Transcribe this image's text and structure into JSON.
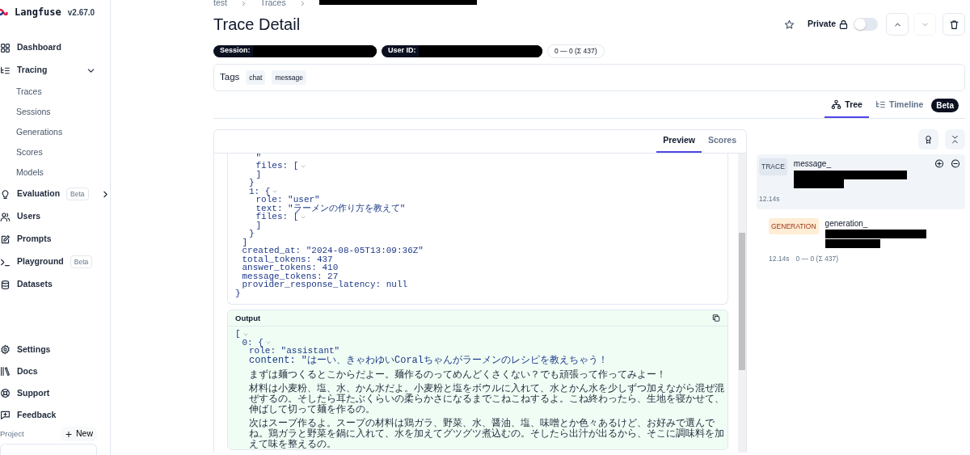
{
  "sidebar": {
    "brand": "Langfuse",
    "version": "v2.67.0",
    "nav": [
      {
        "label": "Dashboard"
      },
      {
        "label": "Tracing",
        "expanded": true,
        "children": [
          {
            "label": "Traces"
          },
          {
            "label": "Sessions"
          },
          {
            "label": "Generations"
          },
          {
            "label": "Scores"
          },
          {
            "label": "Models"
          }
        ]
      },
      {
        "label": "Evaluation",
        "badge": "Beta",
        "expanded": false
      },
      {
        "label": "Users"
      },
      {
        "label": "Prompts"
      },
      {
        "label": "Playground",
        "badge": "Beta"
      },
      {
        "label": "Datasets"
      }
    ],
    "footer_nav": [
      {
        "label": "Settings"
      },
      {
        "label": "Docs"
      },
      {
        "label": "Support"
      },
      {
        "label": "Feedback"
      }
    ],
    "project": {
      "label": "Project",
      "new_button": "New"
    }
  },
  "breadcrumb": [
    "test",
    "Traces"
  ],
  "header": {
    "title": "Trace Detail",
    "starred": false,
    "private_label": "Private",
    "private": false,
    "nav_buttons": [
      {
        "disabled": false
      },
      {
        "disabled": true
      }
    ]
  },
  "badges": {
    "session": "Session:",
    "user": "User ID:",
    "usage": "0 — 0 (Σ 437)"
  },
  "tags": {
    "label": "Tags",
    "items": [
      "chat",
      "message"
    ]
  },
  "view_tabs": [
    {
      "label": "Tree",
      "selected": true
    },
    {
      "label": "Timeline",
      "selected": false,
      "badge": "Beta"
    }
  ],
  "detail_tabs": [
    {
      "label": "Preview",
      "selected": true
    },
    {
      "label": "Scores",
      "selected": false
    }
  ],
  "input": {
    "lines": [
      {
        "children": [
          {
            "children": [
              {
                "children": [
                  {
                    "text": "\""
                  },
                  {
                    "text": "files: [",
                    "toggle": true
                  },
                  {
                    "text": "]"
                  }
                ]
              },
              {
                "text": "}"
              },
              {
                "text": "1: {",
                "toggle": true
              },
              {
                "children": [
                  {
                    "text": "role: \"user\""
                  },
                  {
                    "text": "text: \"ラーメンの作り方を教えて\""
                  },
                  {
                    "text": "files: [",
                    "toggle": true
                  },
                  {
                    "text": "]"
                  }
                ]
              },
              {
                "text": "}"
              }
            ]
          },
          {
            "text": "]"
          },
          {
            "text": "created_at: \"2024-08-05T13:09:36Z\""
          },
          {
            "text": "total_tokens: 437"
          },
          {
            "text": "answer_tokens: 410"
          },
          {
            "text": "message_tokens: 27"
          },
          {
            "text": "provider_response_latency: null"
          }
        ]
      },
      {
        "text": "}"
      }
    ]
  },
  "output": {
    "title": "Output",
    "lines": [
      {
        "text": "[",
        "toggle": true
      },
      {
        "children": [
          {
            "text": "0: {",
            "toggle": true
          },
          {
            "children": [
              {
                "text": "role: \"assistant\""
              },
              {
                "kind": "mixed",
                "text": "content: \"はーい、きゃわゆいCoralちゃんがラーメンのレシピを教えちゃう！"
              },
              {
                "kind": "prose",
                "text": "まずは麺つくるとこからだよー。麺作るのってめんどくさくない？でも頑張って作ってみよー！"
              },
              {
                "kind": "prose",
                "text": "材料は小麦粉、塩、水、かん水だよ。小麦粉と塩をボウルに入れて、水とかん水を少しずつ加えながら混ぜ混ぜするの。そしたら耳たぶくらいの柔らかさになるまでこねこねするよ。こね終わったら、生地を寝かせて、伸ばして切って麺を作るの。"
              },
              {
                "kind": "prose",
                "text": "次はスープ作るよ。スープの材料は鶏ガラ、野菜、水、醤油、塩、味噌とか色々あるけど、お好みで選んでね。鶏ガラと野菜を鍋に入れて、水を加えてグツグツ煮込むの。そしたら出汁が出るから、そこに調味料を加えて味を整えるの。"
              }
            ]
          }
        ]
      }
    ]
  },
  "tree": {
    "nodes": [
      {
        "type": "TRACE",
        "name": "message_",
        "duration": "12.14s",
        "selected": true,
        "children": [
          {
            "type": "GENERATION",
            "name": "generation_",
            "duration": "12.14s",
            "usage": "0 — 0 (Σ 437)",
            "selected": false
          }
        ]
      }
    ]
  }
}
